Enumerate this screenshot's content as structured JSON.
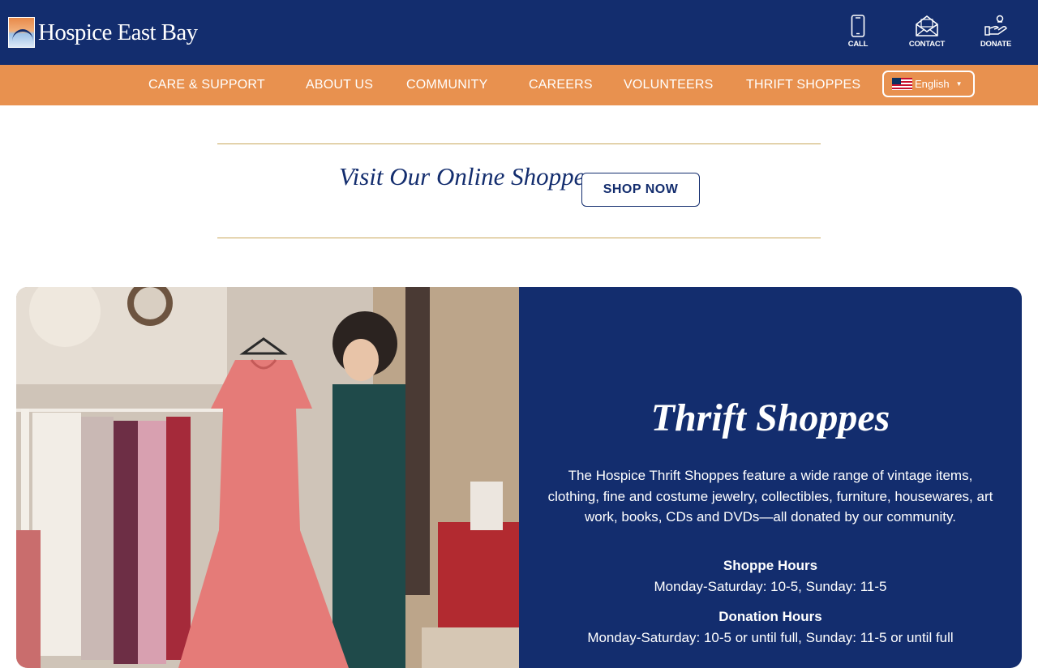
{
  "header": {
    "logo_text": "Hospice East Bay",
    "utility": [
      {
        "label": "CALL",
        "icon": "phone-icon"
      },
      {
        "label": "CONTACT",
        "icon": "envelope-icon"
      },
      {
        "label": "DONATE",
        "icon": "donate-hand-icon"
      }
    ]
  },
  "nav": {
    "items": [
      "CARE & SUPPORT",
      "ABOUT US",
      "COMMUNITY",
      "CAREERS",
      "VOLUNTEERS",
      "THRIFT SHOPPES"
    ],
    "language": "English"
  },
  "promo": {
    "title": "Visit Our Online Shoppe",
    "button": "SHOP NOW"
  },
  "feature": {
    "title": "Thrift Shoppes",
    "description": "The Hospice Thrift Shoppes feature a wide range of vintage items, clothing, fine and costume jewelry, collectibles, furniture, housewares, art work, books, CDs and DVDs—all donated by our community.",
    "shoppe_hours_heading": "Shoppe Hours",
    "shoppe_hours": "Monday-Saturday: 10-5, Sunday: 11-5",
    "donation_hours_heading": "Donation Hours",
    "donation_hours": "Monday-Saturday: 10-5 or until full, Sunday: 11-5 or until full"
  },
  "colors": {
    "navy": "#132d6e",
    "orange": "#e8914f",
    "gold_rule": "#c9a75a"
  }
}
